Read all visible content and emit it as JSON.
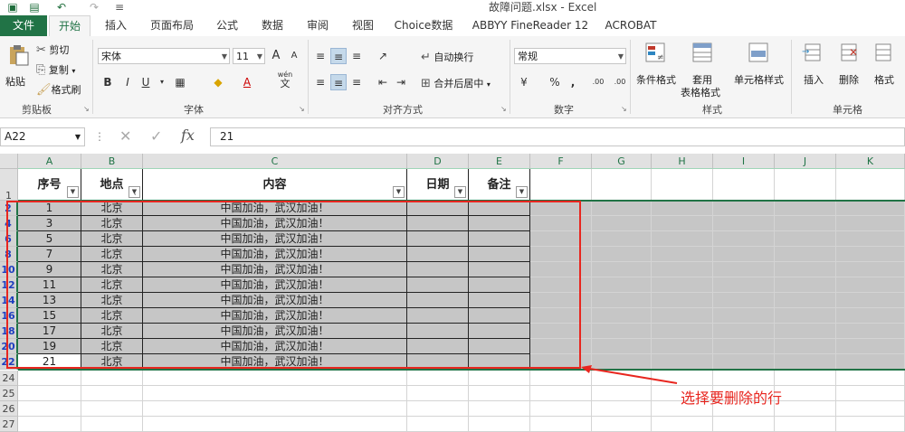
{
  "titlebar": {
    "title": "故障问题.xlsx - Excel"
  },
  "tabs": [
    "文件",
    "开始",
    "插入",
    "页面布局",
    "公式",
    "数据",
    "审阅",
    "视图",
    "Choice数据",
    "ABBYY FineReader 12",
    "ACROBAT"
  ],
  "ribbon": {
    "clipboard": {
      "paste": "粘贴",
      "cut": "剪切",
      "copy": "复制",
      "painter": "格式刷",
      "label": "剪贴板"
    },
    "font": {
      "name": "宋体",
      "size": "11",
      "bold": "B",
      "italic": "I",
      "underline": "U",
      "label": "字体",
      "grow": "A",
      "shrink": "A",
      "wen": "wén",
      "wen2": "文",
      "fontcolor": "A"
    },
    "align": {
      "wrap": "自动换行",
      "merge": "合并后居中",
      "label": "对齐方式"
    },
    "number": {
      "format": "常规",
      "percent": "%",
      "comma": ",",
      "inc": ".00",
      "dec": ".00",
      "label": "数字"
    },
    "styles": {
      "cond": "条件格式",
      "table1": "套用",
      "table2": "表格格式",
      "cell": "单元格样式",
      "label": "样式"
    },
    "cells": {
      "insert": "插入",
      "delete": "删除",
      "format": "格式",
      "label": "单元格"
    }
  },
  "formula_bar": {
    "namebox": "A22",
    "value": "21",
    "fx": "fx"
  },
  "columns": [
    "A",
    "B",
    "C",
    "D",
    "E",
    "F",
    "G",
    "H",
    "I",
    "J",
    "K"
  ],
  "table_header": [
    "序号",
    "地点",
    "内容",
    "日期",
    "备注"
  ],
  "row_labels": {
    "r1": "1",
    "rows": [
      "2",
      "4",
      "6",
      "8",
      "10",
      "12",
      "14",
      "16",
      "18",
      "20",
      "22"
    ],
    "after": [
      "24",
      "25",
      "26",
      "27"
    ]
  },
  "rows": [
    [
      "1",
      "北京",
      "中国加油，武汉加油！"
    ],
    [
      "3",
      "北京",
      "中国加油，武汉加油！"
    ],
    [
      "5",
      "北京",
      "中国加油，武汉加油！"
    ],
    [
      "7",
      "北京",
      "中国加油，武汉加油！"
    ],
    [
      "9",
      "北京",
      "中国加油，武汉加油！"
    ],
    [
      "11",
      "北京",
      "中国加油，武汉加油！"
    ],
    [
      "13",
      "北京",
      "中国加油，武汉加油！"
    ],
    [
      "15",
      "北京",
      "中国加油，武汉加油！"
    ],
    [
      "17",
      "北京",
      "中国加油，武汉加油！"
    ],
    [
      "19",
      "北京",
      "中国加油，武汉加油！"
    ],
    [
      "21",
      "北京",
      "中国加油，武汉加油！"
    ]
  ],
  "annotation": "选择要删除的行",
  "colors": {
    "excel_green": "#217346",
    "selection_gray": "#c6c6c6",
    "annotation_red": "#e8261f"
  }
}
